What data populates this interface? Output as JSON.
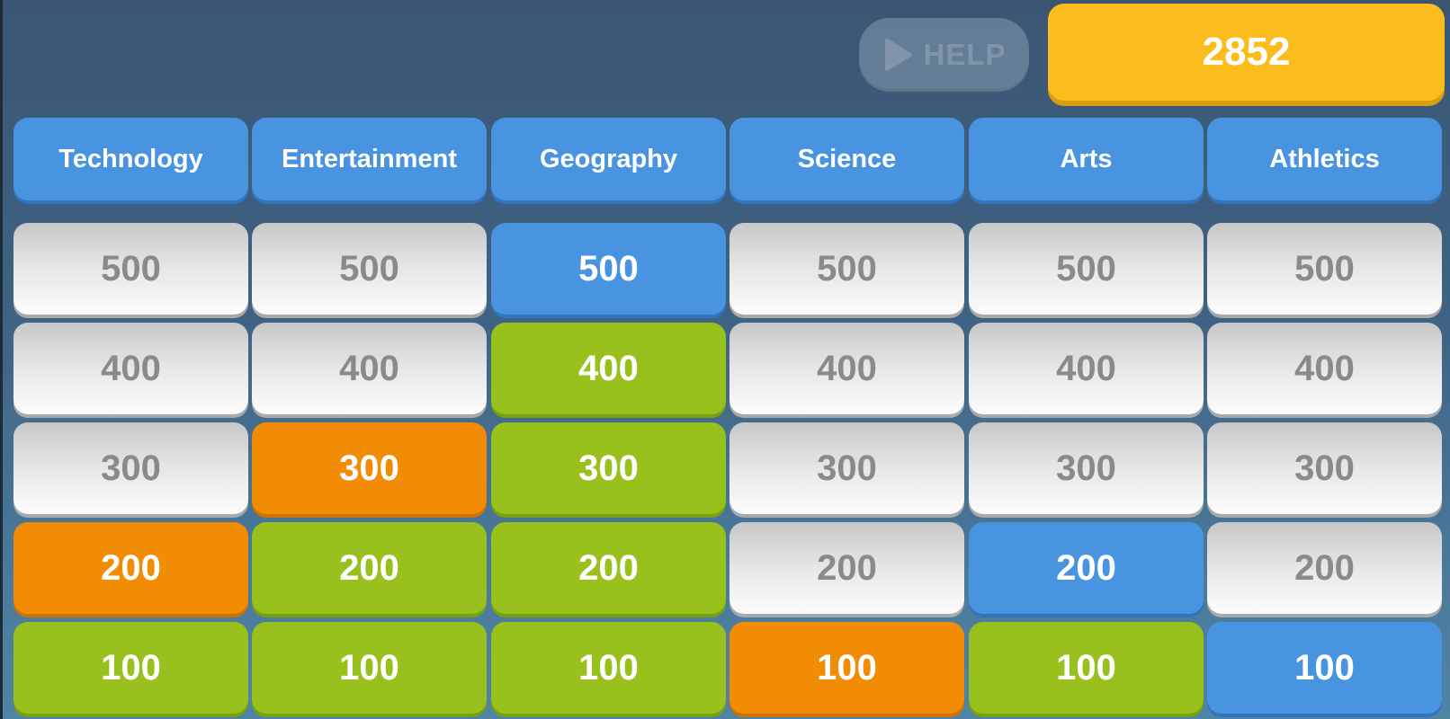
{
  "header": {
    "help_label": "HELP",
    "score": "2852"
  },
  "categories": [
    "Technology",
    "Entertainment",
    "Geography",
    "Science",
    "Arts",
    "Athletics"
  ],
  "colors": {
    "gray": "#e7e7e7",
    "blue": "#4894e1",
    "green": "#98c11e",
    "orange": "#f28c05",
    "score": "#fbbd1d"
  },
  "board": [
    [
      {
        "value": "500",
        "state": "gray"
      },
      {
        "value": "400",
        "state": "gray"
      },
      {
        "value": "300",
        "state": "gray"
      },
      {
        "value": "200",
        "state": "orange"
      },
      {
        "value": "100",
        "state": "green"
      }
    ],
    [
      {
        "value": "500",
        "state": "gray"
      },
      {
        "value": "400",
        "state": "gray"
      },
      {
        "value": "300",
        "state": "orange"
      },
      {
        "value": "200",
        "state": "green"
      },
      {
        "value": "100",
        "state": "green"
      }
    ],
    [
      {
        "value": "500",
        "state": "blue"
      },
      {
        "value": "400",
        "state": "green"
      },
      {
        "value": "300",
        "state": "green"
      },
      {
        "value": "200",
        "state": "green"
      },
      {
        "value": "100",
        "state": "green"
      }
    ],
    [
      {
        "value": "500",
        "state": "gray"
      },
      {
        "value": "400",
        "state": "gray"
      },
      {
        "value": "300",
        "state": "gray"
      },
      {
        "value": "200",
        "state": "gray"
      },
      {
        "value": "100",
        "state": "orange"
      }
    ],
    [
      {
        "value": "500",
        "state": "gray"
      },
      {
        "value": "400",
        "state": "gray"
      },
      {
        "value": "300",
        "state": "gray"
      },
      {
        "value": "200",
        "state": "blue"
      },
      {
        "value": "100",
        "state": "green"
      }
    ],
    [
      {
        "value": "500",
        "state": "gray"
      },
      {
        "value": "400",
        "state": "gray"
      },
      {
        "value": "300",
        "state": "gray"
      },
      {
        "value": "200",
        "state": "gray"
      },
      {
        "value": "100",
        "state": "blue"
      }
    ]
  ]
}
